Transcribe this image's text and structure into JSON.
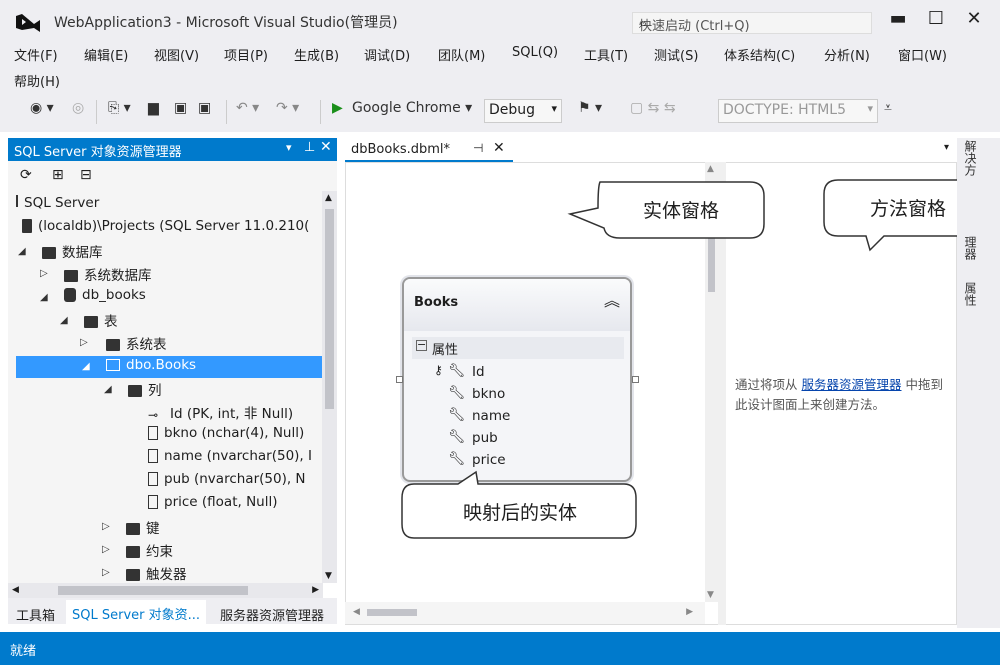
{
  "title": {
    "window_title": "WebApplication3 - Microsoft Visual Studio(管理员)",
    "quick_launch": "快速启动 (Ctrl+Q)"
  },
  "menu": {
    "items": [
      "文件(F)",
      "编辑(E)",
      "视图(V)",
      "项目(P)",
      "生成(B)",
      "调试(D)",
      "团队(M)",
      "SQL(Q)",
      "工具(T)",
      "测试(S)",
      "体系结构(C)",
      "分析(N)",
      "窗口(W)"
    ],
    "help": "帮助(H)"
  },
  "toolbar": {
    "browser": "Google Chrome",
    "config": "Debug",
    "doctype": "DOCTYPE:  HTML5"
  },
  "left_panel": {
    "title": "SQL Server 对象资源管理器",
    "tree": {
      "root": "SQL Server",
      "server": "(localdb)\\Projects (SQL Server 11.0.210(",
      "databases": "数据库",
      "system_dbs": "系统数据库",
      "db": "db_books",
      "tables": "表",
      "system_tables": "系统表",
      "table": "dbo.Books",
      "columns": "列",
      "col1": "Id (PK, int, 非 Null)",
      "col2": "bkno (nchar(4), Null)",
      "col3": "name (nvarchar(50), I",
      "col4": "pub (nvarchar(50), N",
      "col5": "price (float, Null)",
      "keys": "键",
      "constraints": "约束",
      "triggers": "触发器"
    },
    "tabs": [
      "工具箱",
      "SQL Server 对象资...",
      "服务器资源管理器"
    ]
  },
  "document": {
    "tab": "dbBooks.dbml*",
    "entity_name": "Books",
    "section": "属性",
    "props": [
      "Id",
      "bkno",
      "name",
      "pub",
      "price"
    ],
    "hint_prefix": "通过将项从 ",
    "hint_link": "服务器资源管理器",
    "hint_suffix": " 中拖到此设计图面上来创建方法。"
  },
  "callouts": {
    "entity_pane": "实体窗格",
    "method_pane": "方法窗格",
    "mapped_entity": "映射后的实体"
  },
  "right_strip": {
    "tab1": "解决方",
    "tab2": "理器",
    "tab3": "属性"
  },
  "status": "就绪",
  "colors": {
    "accent": "#007acc",
    "selection": "#3399ff",
    "link": "#0645ad"
  }
}
